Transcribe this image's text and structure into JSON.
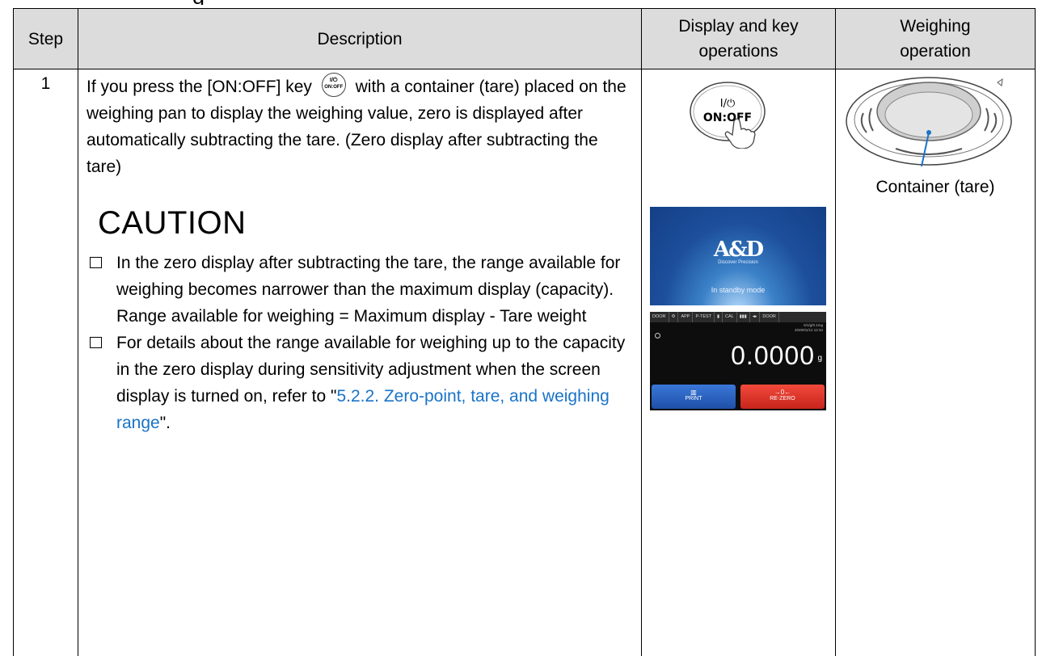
{
  "header": {
    "step": "Step",
    "description": "Description",
    "display_line1": "Display and key",
    "display_line2": "operations",
    "weighing_line1": "Weighing",
    "weighing_line2": "operation"
  },
  "row": {
    "step_number": "1",
    "para_part1": "If you press the [ON:OFF] key",
    "key_inline_label": "ON:OFF",
    "para_part2": "with a container (tare) placed on the weighing pan to display the weighing value, zero is displayed after automatically subtracting the tare. (Zero display after subtracting the tare)",
    "caution_title": "CAUTION",
    "bullet1_line1": "In the zero display after subtracting the tare, the range available for weighing becomes narrower than the maximum display (capacity).",
    "bullet1_line2": "Range available for weighing = Maximum display - Tare weight",
    "bullet2_text": "For details about the range available for weighing up to the capacity in the zero display during sensitivity adjustment when the screen display is turned on, refer to \"",
    "bullet2_link": "5.2.2. Zero-point, tare, and weighing range",
    "bullet2_end": "\"."
  },
  "display": {
    "key_label_top": "I/⏻",
    "key_label_bottom": "ON:OFF",
    "standby_logo": "A&D",
    "standby_tagline": "Discover Precision",
    "standby_mode": "In standby mode",
    "status_items": [
      "DOOR",
      "⚙",
      "APP",
      "P-TEST",
      "▮",
      "CAL",
      "▮▮▮",
      "◂▸",
      "DOOR"
    ],
    "date_line1": "5/1/g/0.1mg",
    "date_line2": "2025/01/12  12:34",
    "weight_value": "0.0000",
    "weight_unit": "g",
    "print_label": "PRINT",
    "rezero_icon": "→0←",
    "rezero_label": "RE-ZERO"
  },
  "weighing": {
    "container_label": "Container (tare)"
  },
  "colors": {
    "link": "#1a73c8",
    "header_bg": "#dcdcdc",
    "print_button": "#2a64c4",
    "rezero_button": "#e0342a"
  }
}
